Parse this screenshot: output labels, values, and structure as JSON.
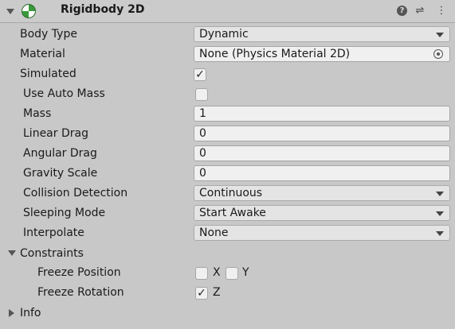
{
  "header": {
    "title": "Rigidbody 2D",
    "help_icon": "?",
    "settings_icon": "⇌",
    "menu_icon": "⋮"
  },
  "rows": {
    "body_type": {
      "label": "Body Type",
      "value": "Dynamic"
    },
    "material": {
      "label": "Material",
      "value": "None (Physics Material 2D)"
    },
    "simulated": {
      "label": "Simulated",
      "checked": "✓"
    },
    "use_auto_mass": {
      "label": "Use Auto Mass",
      "checked": ""
    },
    "mass": {
      "label": "Mass",
      "value": "1"
    },
    "linear_drag": {
      "label": "Linear Drag",
      "value": "0"
    },
    "angular_drag": {
      "label": "Angular Drag",
      "value": "0"
    },
    "gravity_scale": {
      "label": "Gravity Scale",
      "value": "0"
    },
    "collision_detection": {
      "label": "Collision Detection",
      "value": "Continuous"
    },
    "sleeping_mode": {
      "label": "Sleeping Mode",
      "value": "Start Awake"
    },
    "interpolate": {
      "label": "Interpolate",
      "value": "None"
    }
  },
  "constraints": {
    "label": "Constraints",
    "freeze_position": {
      "label": "Freeze Position",
      "x_label": "X",
      "y_label": "Y",
      "x_checked": "",
      "y_checked": ""
    },
    "freeze_rotation": {
      "label": "Freeze Rotation",
      "z_label": "Z",
      "z_checked": "✓"
    }
  },
  "info": {
    "label": "Info"
  }
}
